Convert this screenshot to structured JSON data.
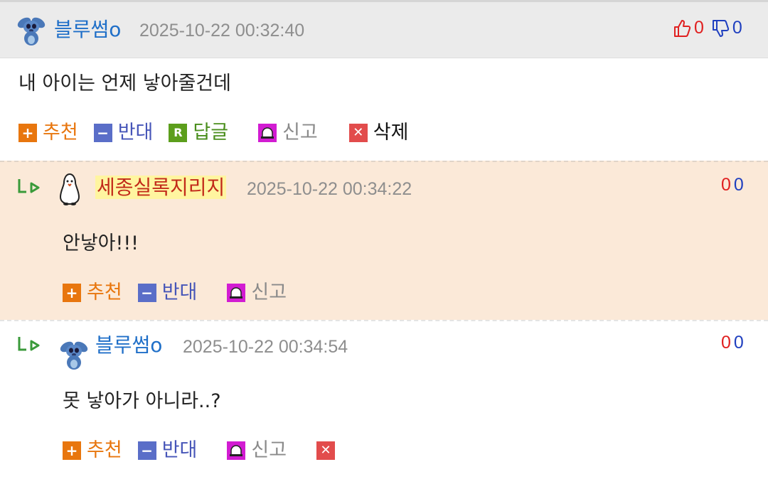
{
  "comment": {
    "author": "블루썸o",
    "date": "2025-10-22 00:32:40",
    "text": "내 아이는 언제 낳아줄건데",
    "votes": {
      "up": "0",
      "down": "0"
    },
    "actions": {
      "recommend": "추천",
      "oppose": "반대",
      "reply": "답글",
      "report": "신고",
      "delete": "삭제"
    }
  },
  "replies": [
    {
      "author": "세종실록지리지",
      "date": "2025-10-22 00:34:22",
      "text": "안낳아!!!",
      "votes": {
        "up": "0",
        "down": "0"
      },
      "actions": {
        "recommend": "추천",
        "oppose": "반대",
        "report": "신고"
      }
    },
    {
      "author": "블루썸o",
      "date": "2025-10-22 00:34:54",
      "text": "못 낳아가 아니라..?",
      "votes": {
        "up": "0",
        "down": "0"
      },
      "actions": {
        "recommend": "추천",
        "oppose": "반대",
        "report": "신고"
      }
    }
  ],
  "colors": {
    "nick": "#1f6fc8",
    "up": "#e02020",
    "down": "#1f3fbf",
    "reply_bg": "#fbe9d8",
    "header_bg": "#ebebeb"
  },
  "icons": [
    "stitch-avatar-icon",
    "penguin-avatar-icon",
    "thumbs-up-icon",
    "thumbs-down-icon",
    "reply-arrow-icon",
    "plus-icon",
    "minus-icon",
    "reply-r-icon",
    "siren-icon",
    "delete-x-icon"
  ]
}
